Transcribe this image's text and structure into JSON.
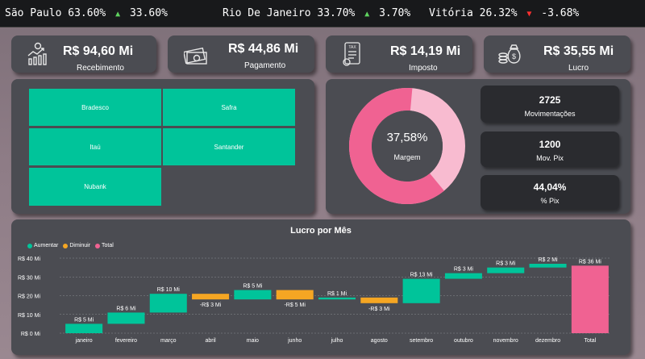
{
  "ticker": [
    {
      "city": "São Paulo",
      "value": "63.60%",
      "direction": "up",
      "change": "33.60%"
    },
    {
      "city": "Rio De Janeiro",
      "value": "33.70%",
      "direction": "up",
      "change": "3.70%"
    },
    {
      "city": "Vitória",
      "value": "26.32%",
      "direction": "down",
      "change": "-3.68%"
    }
  ],
  "kpis": [
    {
      "value": "R$ 94,60 Mi",
      "label": "Recebimento",
      "icon": "growth-chart-icon"
    },
    {
      "value": "R$ 44,86 Mi",
      "label": "Pagamento",
      "icon": "cash-icon"
    },
    {
      "value": "R$ 14,19 Mi",
      "label": "Imposto",
      "icon": "tax-document-icon"
    },
    {
      "value": "R$ 35,55 Mi",
      "label": "Lucro",
      "icon": "money-bag-icon"
    }
  ],
  "treemap": {
    "color": "#00c49a",
    "items": [
      {
        "label": "Bradesco"
      },
      {
        "label": "Safra"
      },
      {
        "label": "Itaú"
      },
      {
        "label": "Santander"
      },
      {
        "label": "Nubank"
      }
    ]
  },
  "donut": {
    "value": "37,58%",
    "label": "Margem",
    "fraction": 0.3758,
    "colors": {
      "primary": "#f06292",
      "secondary": "#f8bbd0",
      "center": "#4b4c52"
    }
  },
  "stats": [
    {
      "value": "2725",
      "label": "Movimentações"
    },
    {
      "value": "1200",
      "label": "Mov. Pix"
    },
    {
      "value": "44,04%",
      "label": "% Pix"
    }
  ],
  "chart_data": {
    "type": "waterfall",
    "title": "Lucro por Mês",
    "legend": [
      {
        "name": "Aumentar",
        "color": "#00c49a"
      },
      {
        "name": "Diminuir",
        "color": "#f5a623"
      },
      {
        "name": "Total",
        "color": "#f06292"
      }
    ],
    "y_ticks": [
      "R$ 0 Mi",
      "R$ 10 Mi",
      "R$ 20 Mi",
      "R$ 30 Mi",
      "R$ 40 Mi"
    ],
    "ylim": [
      0,
      40
    ],
    "categories": [
      "janeiro",
      "fevereiro",
      "março",
      "abril",
      "maio",
      "junho",
      "julho",
      "agosto",
      "setembro",
      "outubro",
      "novembro",
      "dezembro",
      "Total"
    ],
    "values": [
      5,
      6,
      10,
      -3,
      5,
      -5,
      1,
      -3,
      13,
      3,
      3,
      2,
      36
    ],
    "labels": [
      "R$ 5 Mi",
      "R$ 6 Mi",
      "R$ 10 Mi",
      "-R$ 3 Mi",
      "R$ 5 Mi",
      "-R$ 5 Mi",
      "R$ 1 Mi",
      "-R$ 3 Mi",
      "R$ 13 Mi",
      "R$ 3 Mi",
      "R$ 3 Mi",
      "R$ 2 Mi",
      "R$ 36 Mi"
    ],
    "kinds": [
      "up",
      "up",
      "up",
      "down",
      "up",
      "down",
      "up",
      "down",
      "up",
      "up",
      "up",
      "up",
      "total"
    ],
    "grid": true,
    "legend_position": "top-left"
  }
}
